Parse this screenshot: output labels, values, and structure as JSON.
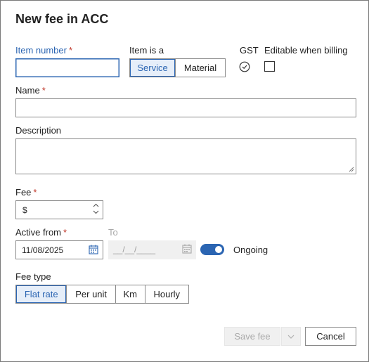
{
  "dialog": {
    "title": "New fee in ACC"
  },
  "item_number": {
    "label": "Item number",
    "required_mark": "*",
    "value": ""
  },
  "item_is_a": {
    "label": "Item is a",
    "options": [
      "Service",
      "Material"
    ],
    "selected": "Service"
  },
  "gst": {
    "label": "GST",
    "checked": true
  },
  "editable_when_billing": {
    "label": "Editable when billing",
    "checked": false
  },
  "name": {
    "label": "Name",
    "required_mark": "*",
    "value": ""
  },
  "description": {
    "label": "Description",
    "value": ""
  },
  "fee": {
    "label": "Fee",
    "required_mark": "*",
    "currency_symbol": "$",
    "value": ""
  },
  "active_from": {
    "label": "Active from",
    "required_mark": "*",
    "value": "11/08/2025"
  },
  "to": {
    "label": "To",
    "placeholder": "__/__/____"
  },
  "ongoing": {
    "label": "Ongoing",
    "enabled": true
  },
  "fee_type": {
    "label": "Fee type",
    "options": [
      "Flat rate",
      "Per unit",
      "Km",
      "Hourly"
    ],
    "selected": "Flat rate"
  },
  "footer": {
    "save_label": "Save fee",
    "cancel_label": "Cancel"
  },
  "colors": {
    "accent": "#2b65b2",
    "required": "#c0392b"
  },
  "icons": [
    "check-circle-icon",
    "calendar-icon",
    "spinner-up-icon",
    "spinner-down-icon",
    "chevron-down-icon",
    "resize-grip-icon"
  ]
}
